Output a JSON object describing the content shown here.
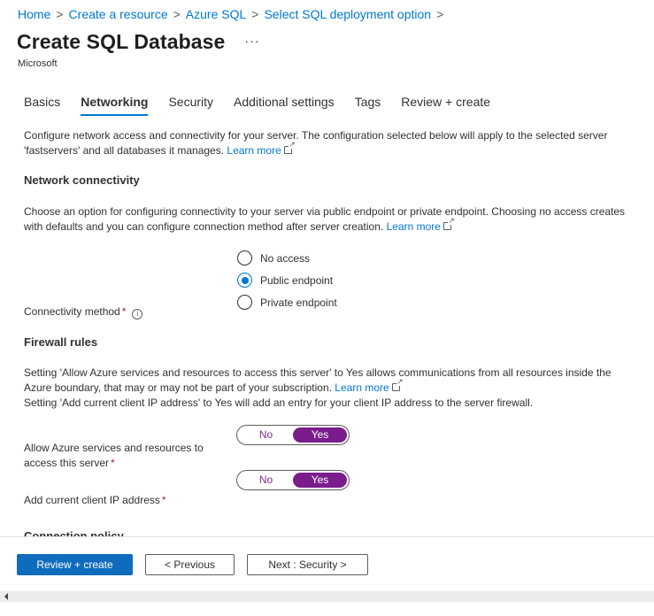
{
  "breadcrumb": [
    {
      "label": "Home"
    },
    {
      "label": "Create a resource"
    },
    {
      "label": "Azure SQL"
    },
    {
      "label": "Select SQL deployment option"
    }
  ],
  "breadcrumb_separator": ">",
  "header": {
    "title": "Create SQL Database",
    "more_label": "···",
    "publisher": "Microsoft"
  },
  "tabs": [
    {
      "label": "Basics",
      "active": false
    },
    {
      "label": "Networking",
      "active": true
    },
    {
      "label": "Security",
      "active": false
    },
    {
      "label": "Additional settings",
      "active": false
    },
    {
      "label": "Tags",
      "active": false
    },
    {
      "label": "Review + create",
      "active": false
    }
  ],
  "intro": {
    "text": "Configure network access and connectivity for your server. The configuration selected below will apply to the selected server 'fastservers' and all databases it manages.",
    "learn_more": "Learn more"
  },
  "network_connectivity": {
    "heading": "Network connectivity",
    "description": "Choose an option for configuring connectivity to your server via public endpoint or private endpoint. Choosing no access creates with defaults and you can configure connection method after server creation.",
    "learn_more": "Learn more",
    "field_label": "Connectivity method",
    "required_mark": "*",
    "info_icon": "i",
    "options": [
      {
        "label": "No access",
        "selected": false
      },
      {
        "label": "Public endpoint",
        "selected": true
      },
      {
        "label": "Private endpoint",
        "selected": false
      }
    ]
  },
  "firewall": {
    "heading": "Firewall rules",
    "description1": "Setting 'Allow Azure services and resources to access this server' to Yes allows communications from all resources inside the Azure boundary, that may or may not be part of your subscription.",
    "learn_more": "Learn more",
    "description2": "Setting 'Add current client IP address' to Yes will add an entry for your client IP address to the server firewall.",
    "allow_azure": {
      "label": "Allow Azure services and resources to access this server",
      "required_mark": "*",
      "no_label": "No",
      "yes_label": "Yes",
      "value": "Yes"
    },
    "client_ip": {
      "label": "Add current client IP address",
      "required_mark": "*",
      "no_label": "No",
      "yes_label": "Yes",
      "value": "Yes"
    }
  },
  "next_section_heading": "Connection policy",
  "footer": {
    "review_create": "Review + create",
    "previous": "< Previous",
    "next": "Next : Security >"
  },
  "colors": {
    "link": "#0078d4",
    "primary_button": "#0f6cbd",
    "toggle_on": "#7a1c8b",
    "required": "#a4262c"
  }
}
